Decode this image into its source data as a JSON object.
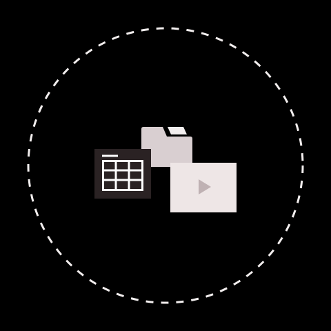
{
  "colors": {
    "background": "#000000",
    "ring": "#f2eeee",
    "folder_back": "#d9cfd1",
    "folder_front": "#d9cfd1",
    "folder_tab_highlight": "#f2eeee",
    "spreadsheet_card": "#2a2223",
    "spreadsheet_grid": "#ffffff",
    "video_card": "#eee6e6",
    "play_glyph": "#bfb1b3"
  },
  "icons": {
    "ring": "dashed-circle",
    "folder": "folder-icon",
    "spreadsheet": "spreadsheet-icon",
    "video": "video-file-icon",
    "play": "play-icon"
  }
}
